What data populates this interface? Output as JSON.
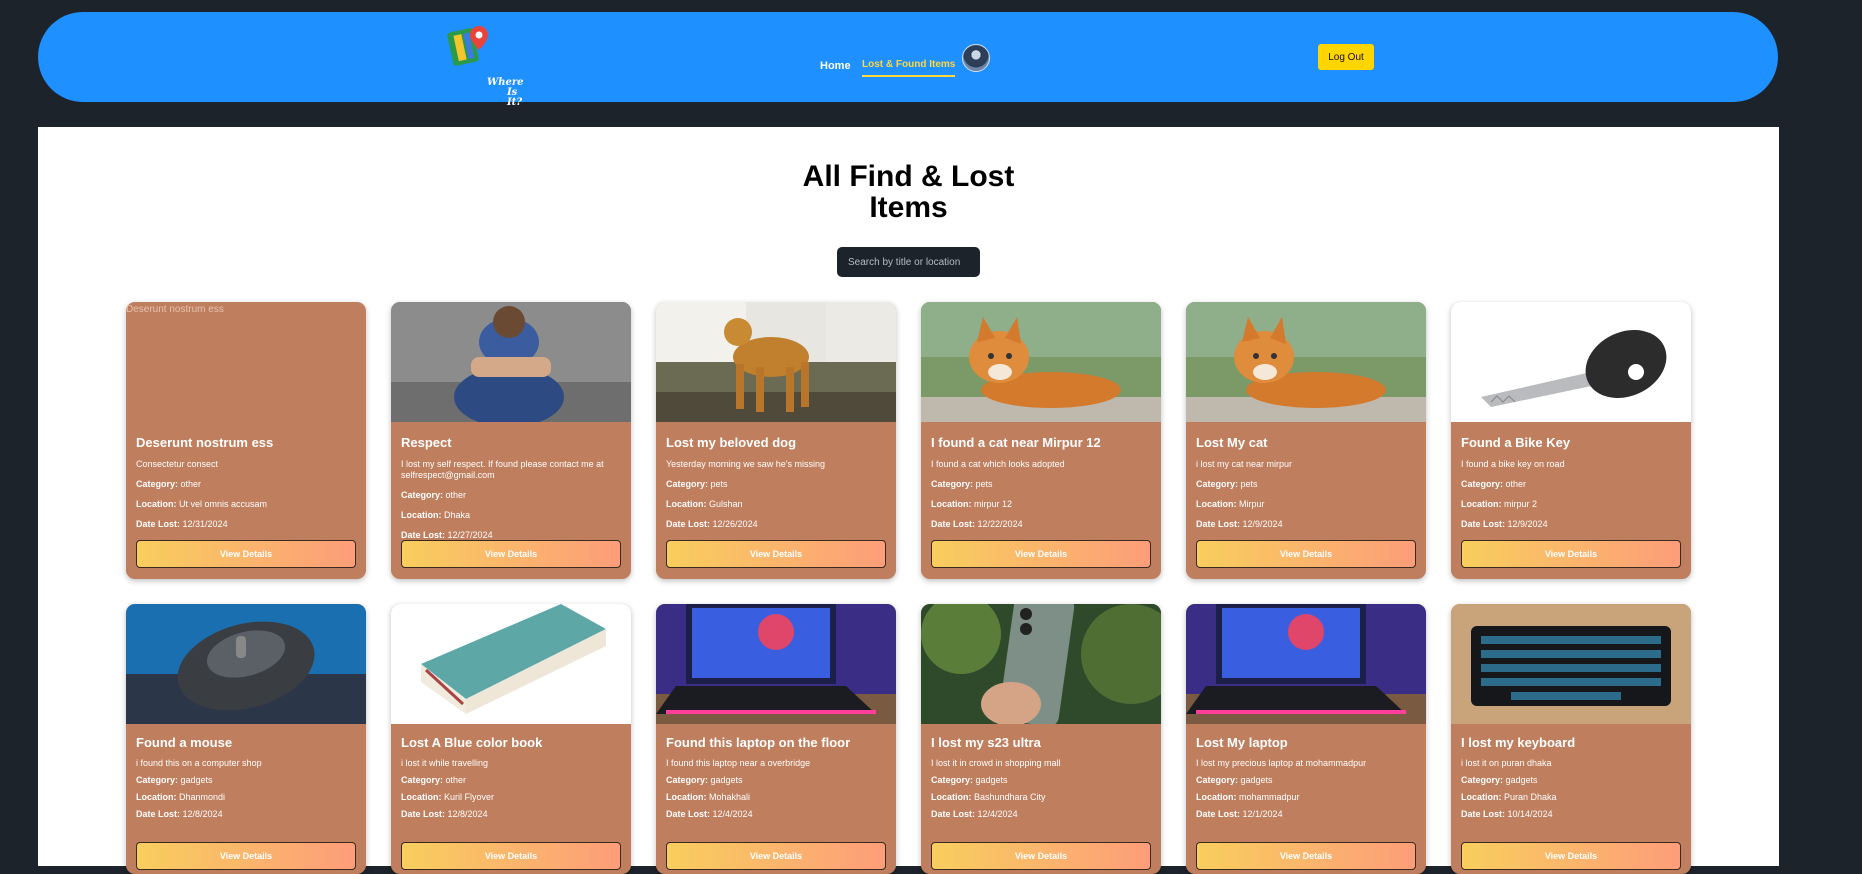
{
  "nav": {
    "logo_line1": "Where",
    "logo_line2": "Is It?",
    "home": "Home",
    "lost_found": "Lost & Found Items",
    "logout": "Log Out"
  },
  "page": {
    "title_line1": "All Find & Lost",
    "title_line2": "Items",
    "search_placeholder": "Search by title or location"
  },
  "labels": {
    "category": "Category:",
    "location": "Location:",
    "date": "Date Lost:",
    "view": "View Details"
  },
  "items": [
    {
      "title": "Deserunt nostrum ess",
      "desc": "Consectetur consect",
      "category": "other",
      "location": "Ut vel omnis accusam",
      "date": "12/31/2024",
      "image": "broken-image",
      "alt": "Deserunt nostrum ess"
    },
    {
      "title": "Respect",
      "desc": "I lost my self respect. If found please contact me at selfrespect@gmail.com",
      "category": "other",
      "location": "Dhaka",
      "date": "12/27/2024",
      "image": "sad-boy-photo"
    },
    {
      "title": "Lost my beloved dog",
      "desc": "Yesterday morning we saw he's missing",
      "category": "pets",
      "location": "Gulshan",
      "date": "12/26/2024",
      "image": "golden-retriever-photo"
    },
    {
      "title": "I found a cat near Mirpur 12",
      "desc": "I found a cat which looks adopted",
      "category": "pets",
      "location": "mirpur 12",
      "date": "12/22/2024",
      "image": "orange-cat-photo"
    },
    {
      "title": "Lost My cat",
      "desc": "i lost my cat near mirpur",
      "category": "pets",
      "location": "Mirpur",
      "date": "12/9/2024",
      "image": "orange-cat-photo"
    },
    {
      "title": "Found a Bike Key",
      "desc": "I found a bike key on road",
      "category": "other",
      "location": "mirpur 2",
      "date": "12/9/2024",
      "image": "bike-key-photo"
    },
    {
      "title": "Found a mouse",
      "desc": "i found this on a computer shop",
      "category": "gadgets",
      "location": "Dhanmondi",
      "date": "12/8/2024",
      "image": "mouse-photo"
    },
    {
      "title": "Lost A Blue color book",
      "desc": "i lost it while travelling",
      "category": "other",
      "location": "Kuril Flyover",
      "date": "12/8/2024",
      "image": "blue-book-photo"
    },
    {
      "title": "Found this laptop on the floor",
      "desc": "I found this laptop near a overbridge",
      "category": "gadgets",
      "location": "Mohakhali",
      "date": "12/4/2024",
      "image": "laptop-photo"
    },
    {
      "title": "I lost my s23 ultra",
      "desc": "I lost it in crowd in shopping mall",
      "category": "gadgets",
      "location": "Bashundhara City",
      "date": "12/4/2024",
      "image": "phone-photo"
    },
    {
      "title": "Lost My laptop",
      "desc": "I lost my precious laptop at mohammadpur",
      "category": "gadgets",
      "location": "mohammadpur",
      "date": "12/1/2024",
      "image": "laptop-photo"
    },
    {
      "title": "I lost my keyboard",
      "desc": "i lost it on puran dhaka",
      "category": "gadgets",
      "location": "Puran Dhaka",
      "date": "10/14/2024",
      "image": "keyboard-photo"
    }
  ]
}
